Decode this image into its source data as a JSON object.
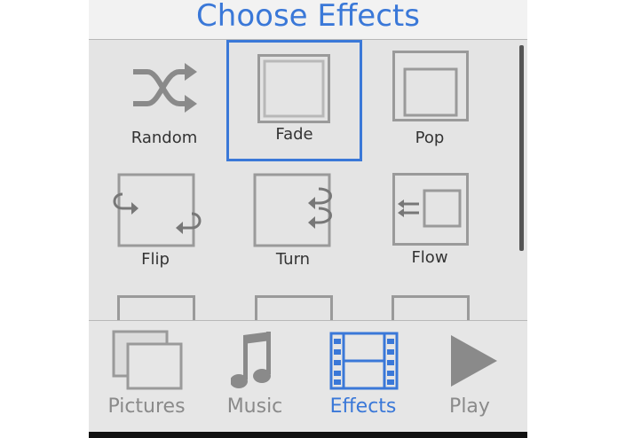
{
  "header": {
    "title": "Choose Effects"
  },
  "effects": [
    {
      "label": "Random",
      "selected": false,
      "icon": "shuffle-icon"
    },
    {
      "label": "Fade",
      "selected": true,
      "icon": "fade-icon"
    },
    {
      "label": "Pop",
      "selected": false,
      "icon": "pop-icon"
    },
    {
      "label": "Flip",
      "selected": false,
      "icon": "flip-icon"
    },
    {
      "label": "Turn",
      "selected": false,
      "icon": "turn-icon"
    },
    {
      "label": "Flow",
      "selected": false,
      "icon": "flow-icon"
    }
  ],
  "tabs": [
    {
      "label": "Pictures",
      "icon": "pictures-icon",
      "active": false
    },
    {
      "label": "Music",
      "icon": "music-note-icon",
      "active": false
    },
    {
      "label": "Effects",
      "icon": "film-strip-icon",
      "active": true
    },
    {
      "label": "Play",
      "icon": "play-icon",
      "active": false
    }
  ],
  "colors": {
    "accent": "#3a78d8",
    "icon_gray": "#8a8a8a",
    "background": "#e6e6e6"
  }
}
